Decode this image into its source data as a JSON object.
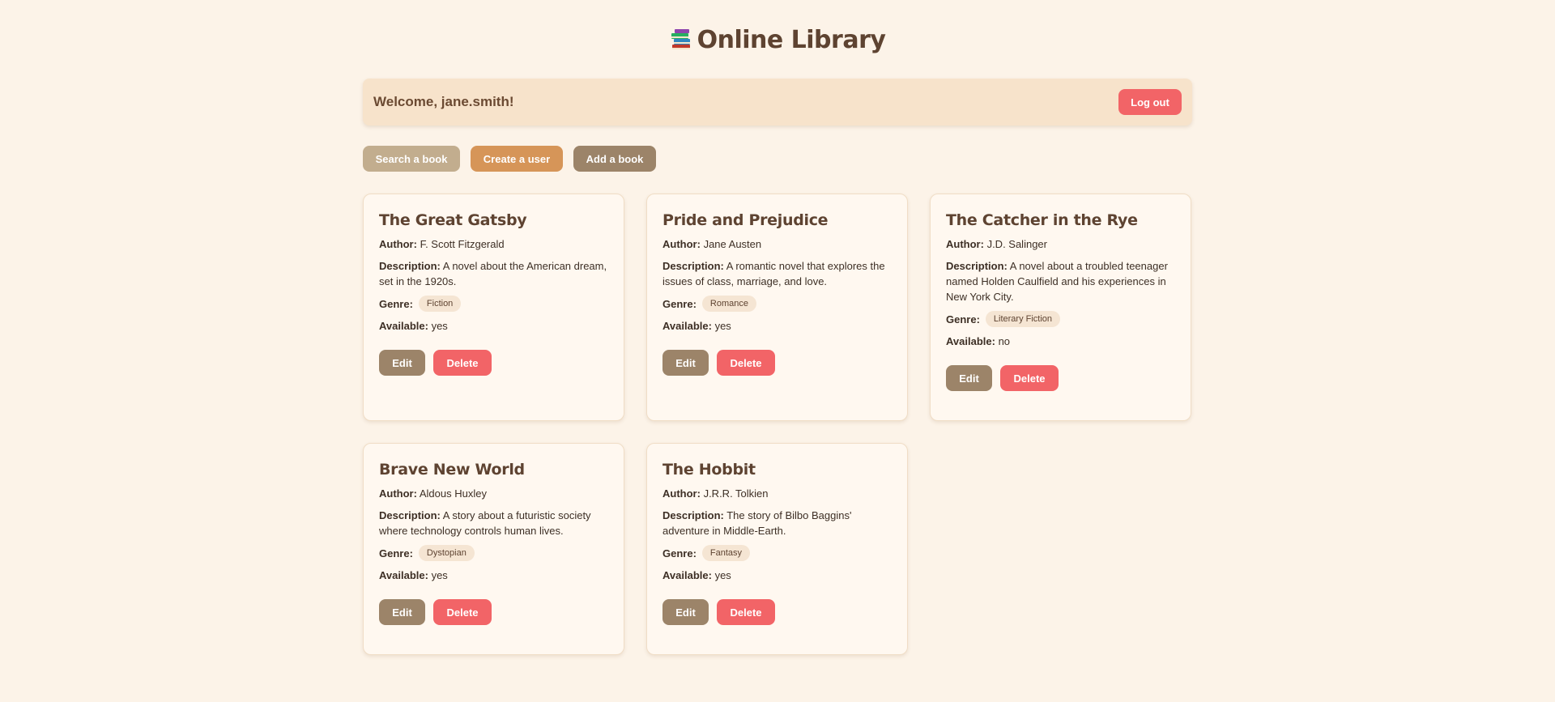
{
  "app": {
    "title": "Online Library",
    "icon": "books-icon"
  },
  "welcome": {
    "text": "Welcome, jane.smith!",
    "logout_label": "Log out"
  },
  "actions": {
    "search_label": "Search a book",
    "create_user_label": "Create a user",
    "add_book_label": "Add a book"
  },
  "labels": {
    "author": "Author:",
    "description": "Description:",
    "genre": "Genre:",
    "available": "Available:",
    "edit": "Edit",
    "delete": "Delete"
  },
  "books": [
    {
      "title": "The Great Gatsby",
      "author": "F. Scott Fitzgerald",
      "description": "A novel about the American dream, set in the 1920s.",
      "genre": "Fiction",
      "available": "yes"
    },
    {
      "title": "Pride and Prejudice",
      "author": "Jane Austen",
      "description": "A romantic novel that explores the issues of class, marriage, and love.",
      "genre": "Romance",
      "available": "yes"
    },
    {
      "title": "The Catcher in the Rye",
      "author": "J.D. Salinger",
      "description": "A novel about a troubled teenager named Holden Caulfield and his experiences in New York City.",
      "genre": "Literary Fiction",
      "available": "no"
    },
    {
      "title": "Brave New World",
      "author": "Aldous Huxley",
      "description": "A story about a futuristic society where technology controls human lives.",
      "genre": "Dystopian",
      "available": "yes"
    },
    {
      "title": "The Hobbit",
      "author": "J.R.R. Tolkien",
      "description": "The story of Bilbo Baggins' adventure in Middle-Earth.",
      "genre": "Fantasy",
      "available": "yes"
    }
  ],
  "colors": {
    "background": "#fcf3e8",
    "accent_brown": "#9c8469",
    "danger": "#f26467",
    "orange": "#d69558",
    "tan": "#c2ad8e"
  }
}
